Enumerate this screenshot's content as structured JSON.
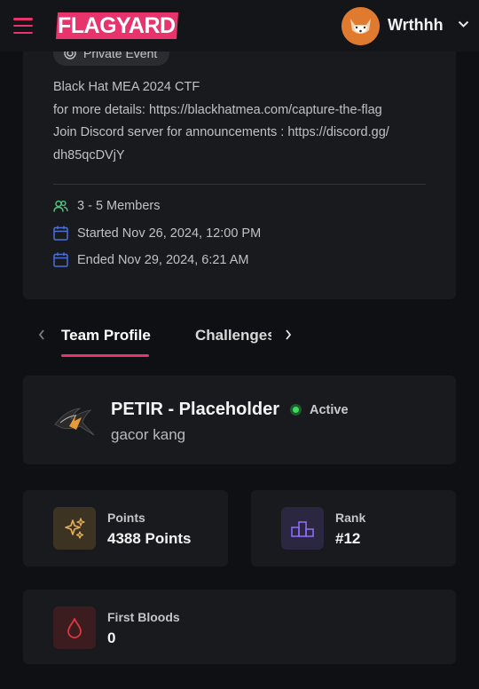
{
  "header": {
    "logo_text": "FLAGYARD",
    "username": "Wrthhh"
  },
  "event": {
    "badge_label": "Private Event",
    "description_lines": [
      "Black Hat MEA 2024 CTF",
      "for more details: https://blackhatmea.com/capture-the-flag",
      "Join Discord server for announcements : https://discord.gg/",
      "dh85qcDVjY"
    ],
    "members": "3 - 5 Members",
    "started": "Started Nov 26, 2024, 12:00 PM",
    "ended": "Ended Nov 29, 2024, 6:21 AM"
  },
  "tabs": {
    "items": [
      {
        "label": "Team Profile",
        "active": true
      },
      {
        "label": "Challenges",
        "active": false
      }
    ]
  },
  "team": {
    "name": "PETIR - Placeholder",
    "status": "Active",
    "subtitle": "gacor kang"
  },
  "stats": {
    "points": {
      "label": "Points",
      "value": "4388 Points",
      "icon": "sparkles-icon",
      "icon_color": "#e5b05c",
      "icon_bg": "#3d3322"
    },
    "rank": {
      "label": "Rank",
      "value": "#12",
      "icon": "podium-icon",
      "icon_color": "#8b6cf0",
      "icon_bg": "#2b2740"
    },
    "first_bloods": {
      "label": "First Bloods",
      "value": "0",
      "icon": "blood-drop-icon",
      "icon_color": "#e0353d",
      "icon_bg": "#3b1d1f"
    }
  },
  "colors": {
    "accent": "#e8336d",
    "background": "#0f1013",
    "card": "#181a1e",
    "status_active": "#3ddc5f",
    "meta_icon_members": "#4ec27a",
    "meta_icon_calendar": "#4b6fd8"
  }
}
